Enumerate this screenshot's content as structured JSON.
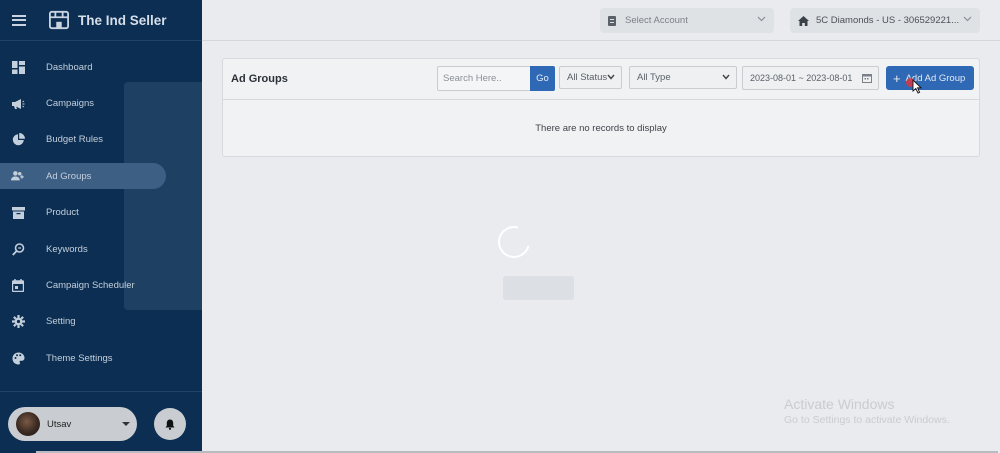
{
  "sidebar": {
    "brand": "The Ind Seller",
    "items": [
      {
        "label": "Dashboard",
        "icon": "dashboard-icon"
      },
      {
        "label": "Campaigns",
        "icon": "megaphone-icon"
      },
      {
        "label": "Budget Rules",
        "icon": "pie-chart-icon"
      },
      {
        "label": "Ad Groups",
        "icon": "user-group-icon"
      },
      {
        "label": "Product",
        "icon": "archive-box-icon"
      },
      {
        "label": "Keywords",
        "icon": "search-key-icon"
      },
      {
        "label": "Campaign Scheduler",
        "icon": "calendar-icon"
      },
      {
        "label": "Setting",
        "icon": "gear-icon"
      },
      {
        "label": "Theme Settings",
        "icon": "palette-icon"
      }
    ],
    "active_item": "Ad Groups",
    "user": {
      "name": "Utsav"
    }
  },
  "header": {
    "account_placeholder": "Select Account",
    "store_label": "5C Diamonds - US - 306529221..."
  },
  "main": {
    "title": "Ad Groups",
    "search_placeholder": "Search Here..",
    "go_label": "Go",
    "status_filter": "All Status",
    "type_filter": "All Type",
    "date_range": "2023-08-01 ~ 2023-08-01",
    "add_button_label": "Add Ad Group",
    "empty_message": "There are no records to display"
  },
  "watermark": {
    "line1": "Activate Windows",
    "line2": "Go to Settings to activate Windows."
  },
  "colors": {
    "sidebar_bg": "#0b2e52",
    "active_item_bg": "#3d5f83",
    "primary_button": "#2f68b4",
    "page_bg": "#e9ebee"
  }
}
